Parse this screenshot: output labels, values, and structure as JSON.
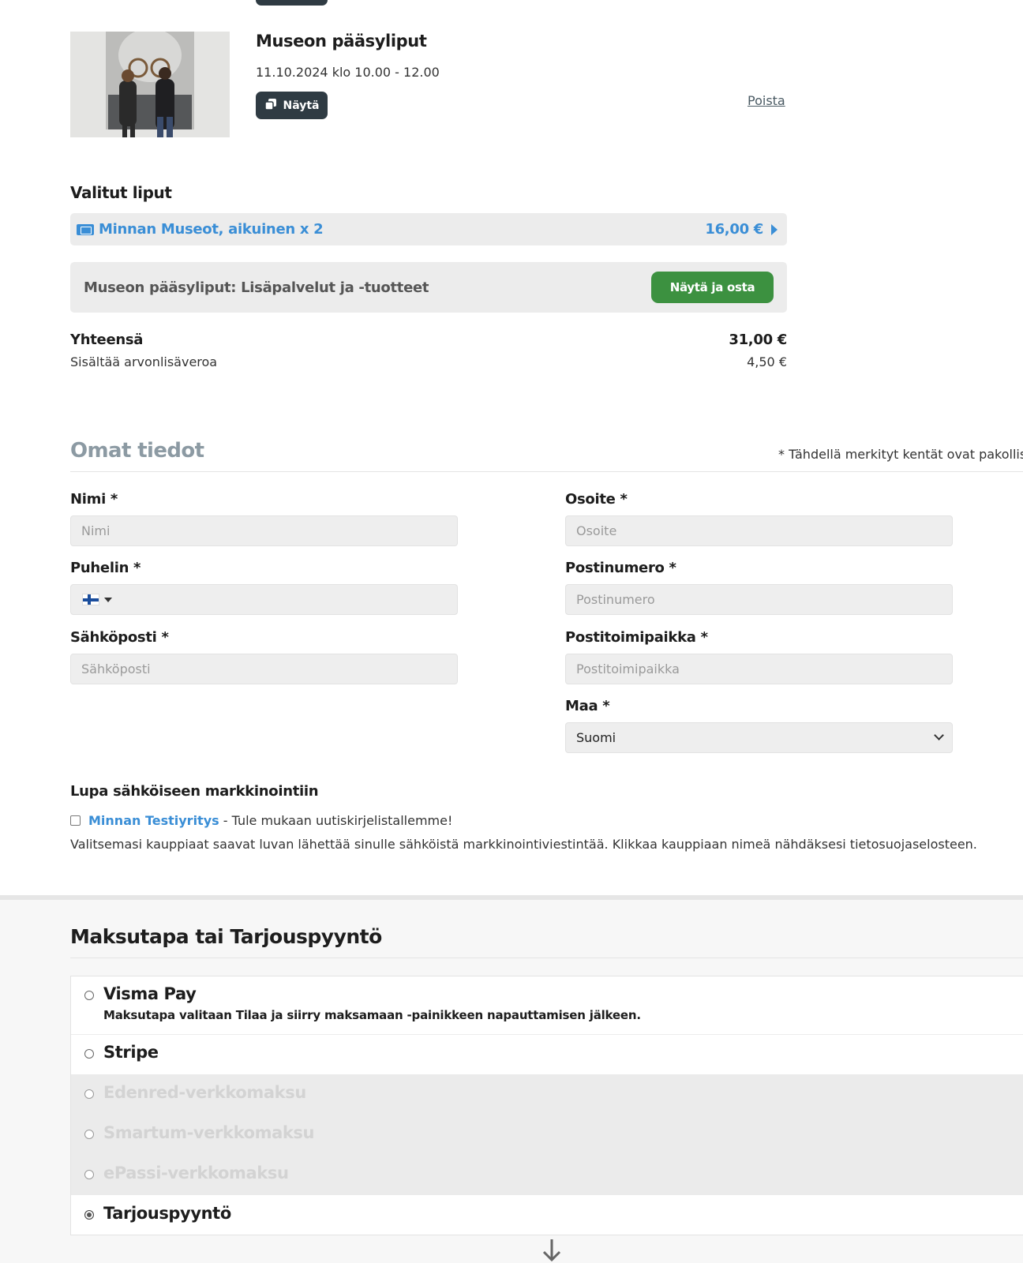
{
  "product": {
    "title": "Museon pääsyliput",
    "date": "11.10.2024 klo 10.00 - 12.00",
    "show_button": "Näytä",
    "remove_link": "Poista"
  },
  "tickets": {
    "heading": "Valitut liput",
    "item_label": "Minnan Museot, aikuinen x 2",
    "item_price": "16,00 €"
  },
  "extras": {
    "label": "Museon pääsyliput: Lisäpalvelut ja -tuotteet",
    "button": "Näytä ja osta"
  },
  "totals": {
    "total_label": "Yhteensä",
    "total_value": "31,00 €",
    "vat_label": "Sisältää arvonlisäveroa",
    "vat_value": "4,50 €"
  },
  "info": {
    "heading": "Omat tiedot",
    "required_note": "* Tähdellä merkityt kentät ovat pakollisia",
    "name_label": "Nimi *",
    "name_placeholder": "Nimi",
    "phone_label": "Puhelin *",
    "email_label": "Sähköposti *",
    "email_placeholder": "Sähköposti",
    "address_label": "Osoite *",
    "address_placeholder": "Osoite",
    "postal_label": "Postinumero *",
    "postal_placeholder": "Postinumero",
    "city_label": "Postitoimipaikka *",
    "city_placeholder": "Postitoimipaikka",
    "country_label": "Maa *",
    "country_value": "Suomi"
  },
  "consent": {
    "heading": "Lupa sähköiseen markkinointiin",
    "merchant": "Minnan Testiyritys",
    "merchant_suffix": " - Tule mukaan uutiskirjelistallemme!",
    "note": "Valitsemasi kauppiaat saavat luvan lähettää sinulle sähköistä markkinointiviestintää. Klikkaa kauppiaan nimeä nähdäksesi tietosuojaselosteen."
  },
  "payment": {
    "heading": "Maksutapa tai Tarjouspyyntö",
    "options": [
      {
        "name": "Visma Pay",
        "desc": "Maksutapa valitaan Tilaa ja siirry maksamaan -painikkeen napauttamisen jälkeen."
      },
      {
        "name": "Stripe"
      },
      {
        "name": "Edenred-verkkomaksu"
      },
      {
        "name": "Smartum-verkkomaksu"
      },
      {
        "name": "ePassi-verkkomaksu"
      },
      {
        "name": "Tarjouspyyntö"
      }
    ]
  },
  "icons": {
    "show": "copy-icon",
    "ticket": "ticket-icon",
    "arrow": "chevron-right-icon",
    "scroll": "arrow-down-icon"
  }
}
